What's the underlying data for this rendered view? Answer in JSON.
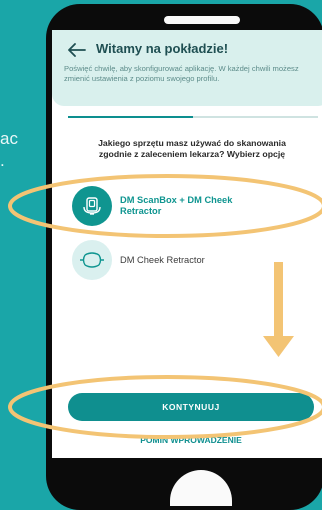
{
  "side_text": [
    "ac",
    "."
  ],
  "header": {
    "back_icon": "arrow-left-icon",
    "title": "Witamy na pokładzie!",
    "subtitle": "Poświęć chwilę, aby skonfigurować aplikację. W każdej chwili możesz zmienić ustawienia z poziomu swojego profilu."
  },
  "progress": {
    "fraction": 0.5
  },
  "question": "Jakiego sprzętu masz używać do skanowania zgodnie z zaleceniem lekarza? Wybierz opcję",
  "options": [
    {
      "label": "DM ScanBox + DM Cheek Retractor",
      "icon": "scanbox-icon",
      "selected": true
    },
    {
      "label": "DM Cheek Retractor",
      "icon": "cheek-retractor-icon",
      "selected": false
    }
  ],
  "continue_label": "KONTYNUUJ",
  "skip_label": "POMIŃ WPROWADZENIE",
  "colors": {
    "background": "#1aa6a8",
    "accent": "#0f8f8f",
    "highlight_ellipse": "#f3c474",
    "arrow": "#f3c474"
  }
}
